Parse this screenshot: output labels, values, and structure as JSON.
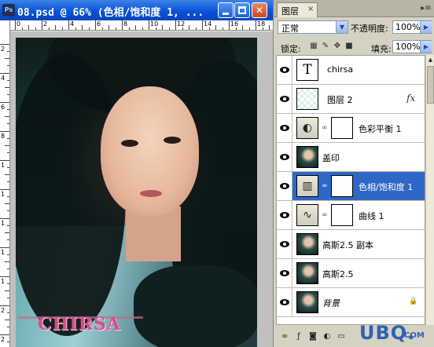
{
  "window": {
    "title": "08.psd @ 66% (色相/饱和度 1, ...",
    "app_icon": "Ps",
    "minimize_icon": "minimize-icon",
    "maximize_icon": "maximize-icon",
    "close_icon": "close-icon"
  },
  "rulers": {
    "horizontal": [
      "0",
      "2",
      "4",
      "6",
      "8",
      "10",
      "12",
      "14",
      "16",
      "18"
    ],
    "vertical": [
      "2",
      "4",
      "6",
      "8",
      "1",
      "1",
      "1",
      "1",
      "1",
      "2",
      "2"
    ]
  },
  "canvas": {
    "watermark_text": "CHIRSA"
  },
  "panel": {
    "tab_label": "图层",
    "tab_close": "×",
    "blend_mode": "正常",
    "opacity_label": "不透明度:",
    "opacity_value": "100%",
    "lock_label": "锁定:",
    "fill_label": "填充:",
    "fill_value": "100%",
    "layers": [
      {
        "name": "chirsa",
        "thumb": "T",
        "type": "text"
      },
      {
        "name": "图层 2",
        "type": "transparent",
        "fx": "fx"
      },
      {
        "name": "色彩平衡 1",
        "type": "adjustment",
        "glyph": "◐"
      },
      {
        "name": "盖印",
        "type": "photo"
      },
      {
        "name": "色相/饱和度 1",
        "type": "adjustment",
        "glyph": "▥",
        "selected": true
      },
      {
        "name": "曲线 1",
        "type": "adjustment",
        "glyph": "∿"
      },
      {
        "name": "高斯2.5 副本",
        "type": "photo"
      },
      {
        "name": "高斯2.5",
        "type": "photo"
      },
      {
        "name": "背景",
        "type": "photo",
        "italic": true,
        "locked": true
      }
    ]
  },
  "site_watermark": {
    "text": "UBQ.",
    "suffix": "COM"
  },
  "colors": {
    "titlebar": "#0a53d8",
    "selection": "#2d67c8",
    "watermark_pink": "#d54d8c",
    "site_blue": "#2d63b5"
  }
}
